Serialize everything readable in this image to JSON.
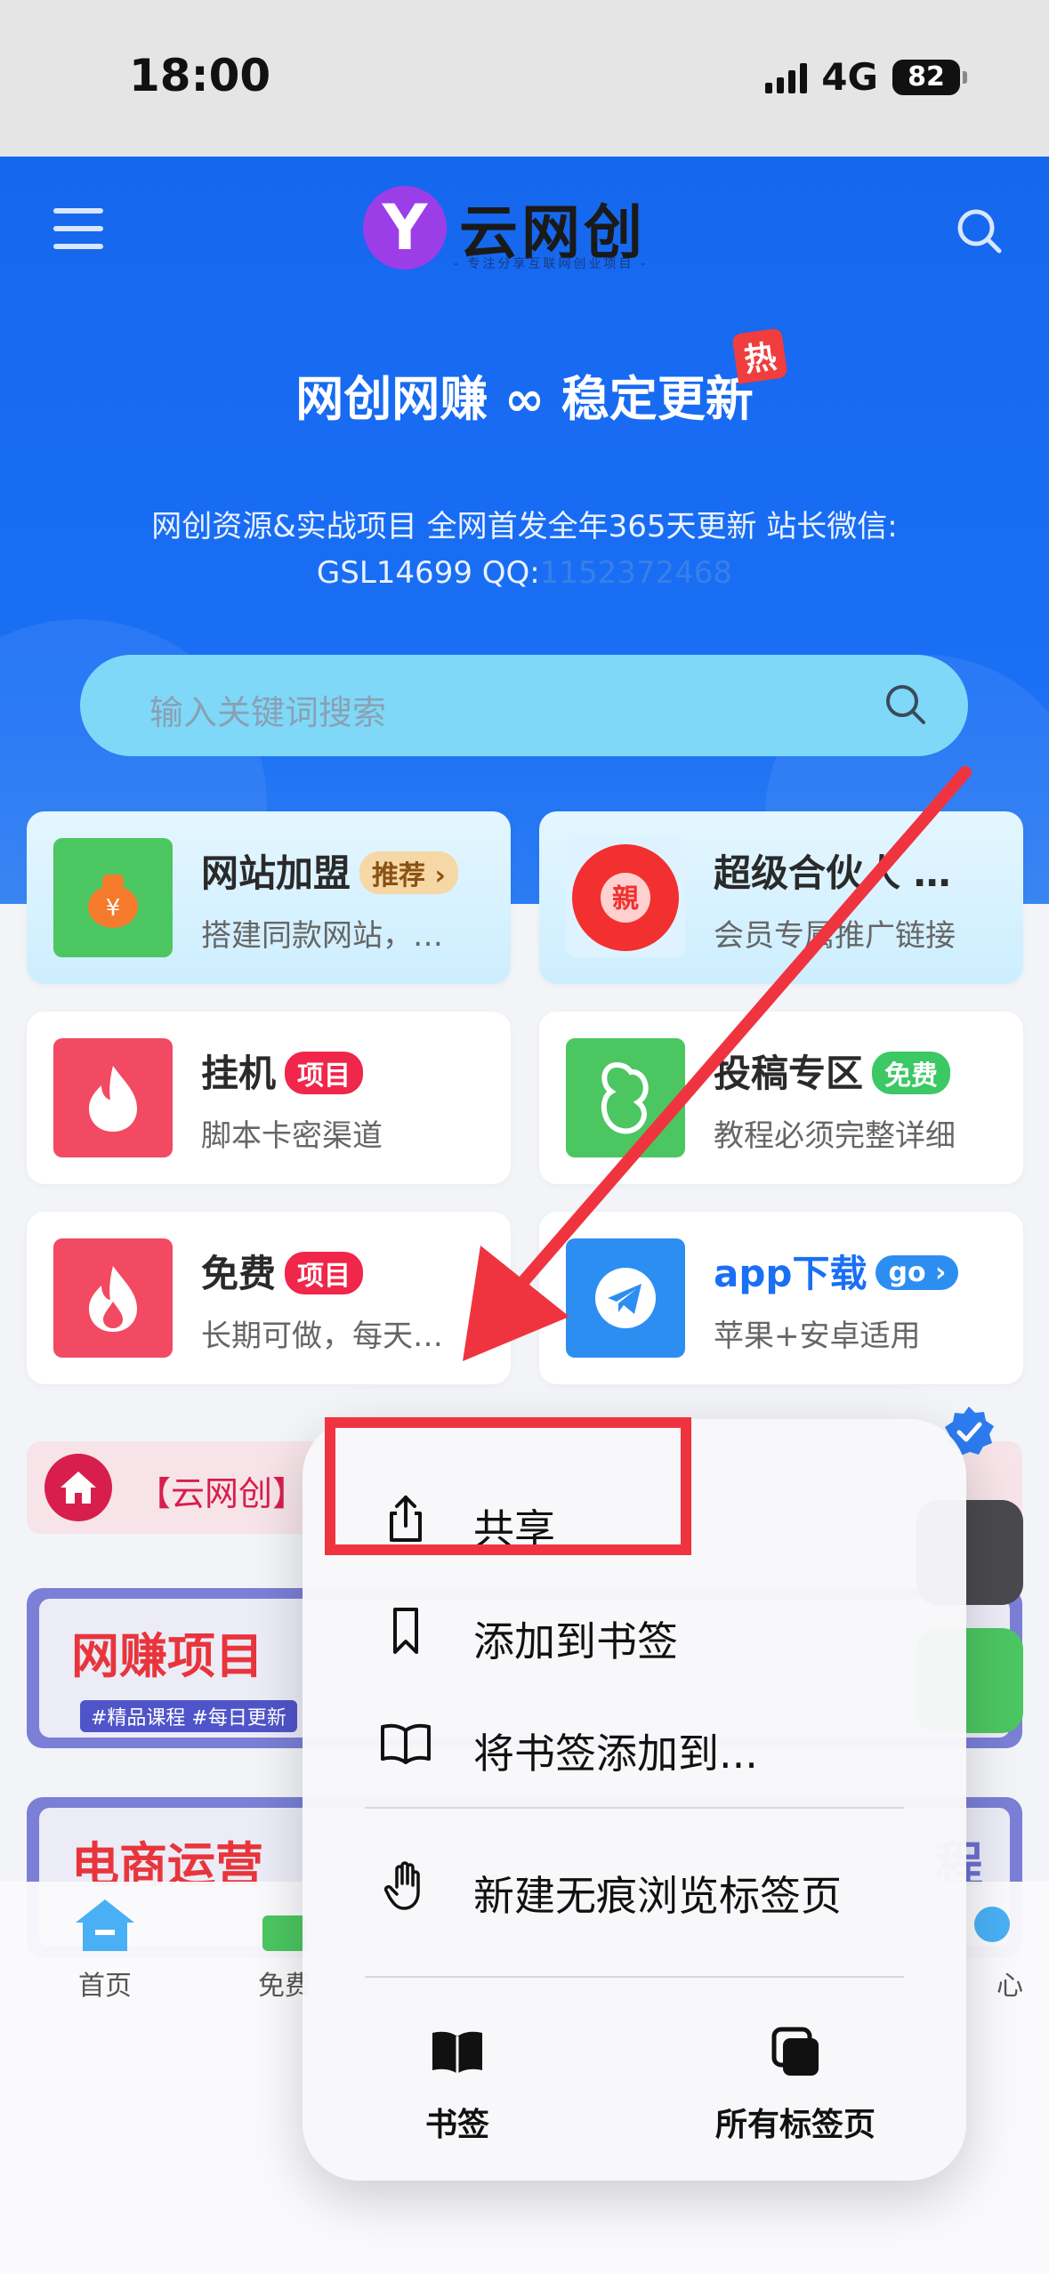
{
  "status_bar": {
    "time": "18:00",
    "network": "4G",
    "battery": "82"
  },
  "header": {
    "logo_letter": "Y",
    "logo_text": "云网创",
    "logo_subtitle": "- 专注分享互联网创业项目 -",
    "title": "网创网赚 ∞ 稳定更新",
    "hot_badge": "热",
    "description_line1": "网创资源&实战项目 全网首发全年365天更新 站长微信:",
    "description_line2_prefix": "GSL14699 QQ:",
    "description_line2_qq": "1152372468"
  },
  "search": {
    "placeholder": "输入关键词搜索"
  },
  "cards": [
    {
      "title": "网站加盟",
      "tag": "推荐 ›",
      "subtitle": "搭建同款网站，…",
      "icon": "money-bag-icon",
      "color": "#4cc661"
    },
    {
      "title": "超级合伙人 …",
      "subtitle": "会员专属推广链接",
      "icon": "red-packet-icon",
      "icon_text": "親",
      "color": "#f23030"
    },
    {
      "title": "挂机",
      "tag": "项目",
      "subtitle": "脚本卡密渠道",
      "icon": "fire-icon",
      "color": "#f24a62"
    },
    {
      "title": "投稿专区",
      "tag": "免费",
      "subtitle": "教程必须完整详细",
      "icon": "cloud-icon",
      "color": "#4cc661"
    },
    {
      "title": "免费",
      "tag": "项目",
      "subtitle": "长期可做，每天…",
      "icon": "fire-icon",
      "color": "#f24a62"
    },
    {
      "title": "app下载",
      "tag": "go ›",
      "subtitle": "苹果+安卓适用",
      "icon": "telegram-icon",
      "color": "#2d8ef2"
    }
  ],
  "notice": {
    "text": "【云网创】"
  },
  "banners": [
    {
      "title": "网赚项目",
      "tags": "#精品课程  #每日更新"
    },
    {
      "title": "电商运营",
      "right_fragment": "程"
    }
  ],
  "tabbar": [
    {
      "label": "首页",
      "icon": "home-icon"
    },
    {
      "label": "免费",
      "icon": "gift-icon"
    },
    {
      "label": "心",
      "icon": "user-center-icon"
    }
  ],
  "context_menu": {
    "items": [
      {
        "label": "共享",
        "icon": "share-icon"
      },
      {
        "label": "添加到书签",
        "icon": "bookmark-icon"
      },
      {
        "label": "将书签添加到...",
        "icon": "book-open-icon"
      },
      {
        "label": "新建无痕浏览标签页",
        "icon": "hand-icon"
      }
    ],
    "bottom": [
      {
        "label": "书签",
        "icon": "book-icon"
      },
      {
        "label": "所有标签页",
        "icon": "tabs-icon"
      }
    ]
  },
  "colors": {
    "brand_blue": "#1567ee",
    "highlight_red": "#ef3440",
    "search_bg": "#7fd8f8"
  }
}
